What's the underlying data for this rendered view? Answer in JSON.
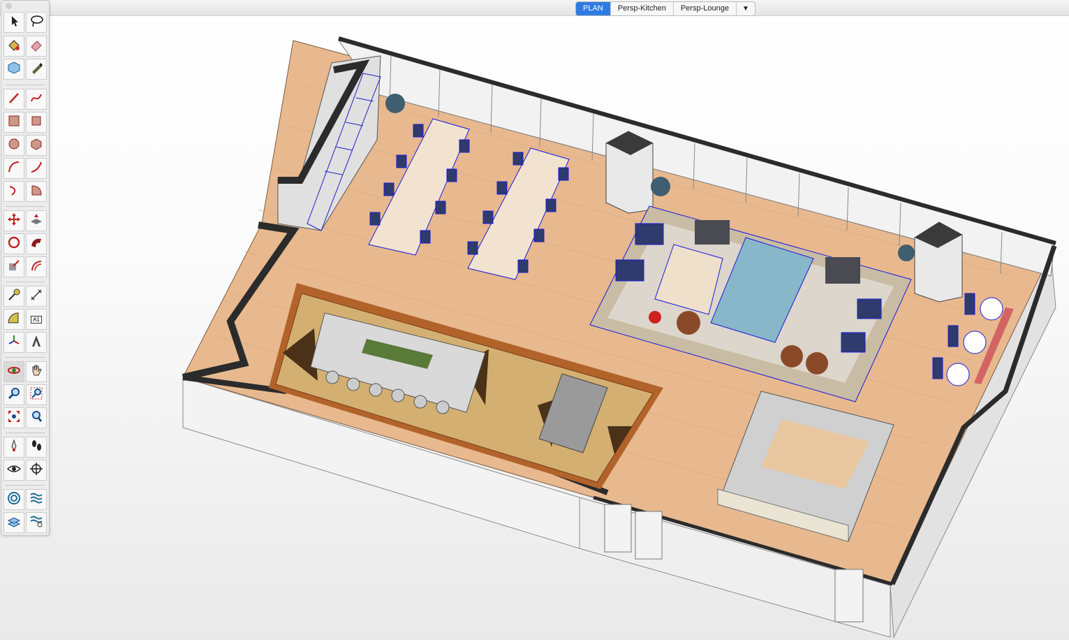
{
  "scene_tabs": [
    {
      "label": "PLAN",
      "active": true
    },
    {
      "label": "Persp-Kitchen",
      "active": false
    },
    {
      "label": "Persp-Lounge",
      "active": false
    }
  ],
  "scene_tabs_menu": "▼",
  "toolbar": {
    "text_tool_badge": "A1",
    "tools": [
      {
        "name": "select-tool",
        "icon": "arrow-icon"
      },
      {
        "name": "lasso-tool",
        "icon": "lasso-icon"
      },
      {
        "name": "paint-bucket-tool",
        "icon": "paint-bucket-icon"
      },
      {
        "name": "eraser-tool",
        "icon": "eraser-icon"
      },
      {
        "name": "component-tool",
        "icon": "component-icon"
      },
      {
        "name": "tag-tool",
        "icon": "tag-icon"
      },
      {
        "name": "line-tool",
        "icon": "pencil-icon"
      },
      {
        "name": "freehand-tool",
        "icon": "freehand-icon"
      },
      {
        "name": "rectangle-tool",
        "icon": "rectangle-icon"
      },
      {
        "name": "rotated-rectangle-tool",
        "icon": "rotated-rectangle-icon"
      },
      {
        "name": "circle-tool",
        "icon": "circle-icon"
      },
      {
        "name": "polygon-tool",
        "icon": "polygon-icon"
      },
      {
        "name": "arc-tool",
        "icon": "arc-icon"
      },
      {
        "name": "two-point-arc-tool",
        "icon": "two-point-arc-icon"
      },
      {
        "name": "three-point-arc-tool",
        "icon": "three-point-arc-icon"
      },
      {
        "name": "pie-tool",
        "icon": "pie-icon"
      },
      {
        "name": "move-tool",
        "icon": "move-icon"
      },
      {
        "name": "push-pull-tool",
        "icon": "push-pull-icon"
      },
      {
        "name": "rotate-tool",
        "icon": "rotate-icon"
      },
      {
        "name": "follow-me-tool",
        "icon": "follow-me-icon"
      },
      {
        "name": "scale-tool",
        "icon": "scale-icon"
      },
      {
        "name": "offset-tool",
        "icon": "offset-icon"
      },
      {
        "name": "tape-measure-tool",
        "icon": "tape-measure-icon"
      },
      {
        "name": "dimension-tool",
        "icon": "dimension-icon"
      },
      {
        "name": "protractor-tool",
        "icon": "protractor-icon"
      },
      {
        "name": "text-tool",
        "icon": "text-icon"
      },
      {
        "name": "axes-tool",
        "icon": "axes-icon"
      },
      {
        "name": "3d-text-tool",
        "icon": "3d-text-icon"
      },
      {
        "name": "orbit-tool",
        "icon": "orbit-icon"
      },
      {
        "name": "pan-tool",
        "icon": "hand-icon"
      },
      {
        "name": "zoom-tool",
        "icon": "magnifier-icon"
      },
      {
        "name": "zoom-window-tool",
        "icon": "zoom-window-icon"
      },
      {
        "name": "zoom-extents-tool",
        "icon": "zoom-extents-icon"
      },
      {
        "name": "previous-view-tool",
        "icon": "previous-view-icon"
      },
      {
        "name": "position-camera-tool",
        "icon": "position-camera-icon"
      },
      {
        "name": "walk-tool",
        "icon": "footprints-icon"
      },
      {
        "name": "look-around-tool",
        "icon": "eye-icon"
      },
      {
        "name": "section-plane-tool",
        "icon": "section-plane-icon"
      },
      {
        "name": "sandbox-from-contours-tool",
        "icon": "sandbox-contours-icon"
      },
      {
        "name": "sandbox-from-scratch-tool",
        "icon": "sandbox-scratch-icon"
      },
      {
        "name": "smoove-tool",
        "icon": "smoove-icon"
      },
      {
        "name": "stamp-tool",
        "icon": "stamp-icon"
      }
    ]
  },
  "colors": {
    "tab_active": "#2f7be3",
    "floor_wood": "#e8b98f",
    "wall_cap": "#333333",
    "selection_blue": "#1a1adc",
    "rug_border": "#b2632a"
  }
}
